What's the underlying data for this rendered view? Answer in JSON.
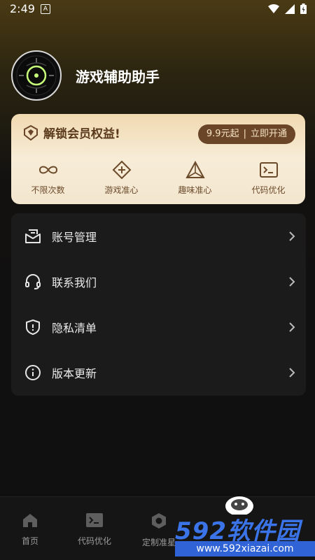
{
  "status": {
    "time": "2:49",
    "notif_glyph": "A"
  },
  "profile": {
    "name": "游戏辅助助手"
  },
  "vip": {
    "title": "解锁会员权益!",
    "price": "9.9元起",
    "action": "立即开通",
    "items": [
      {
        "label": "不限次数",
        "icon": "infinity-icon"
      },
      {
        "label": "游戏准心",
        "icon": "crosshair-diamond-icon"
      },
      {
        "label": "趣味准心",
        "icon": "triangle-icon"
      },
      {
        "label": "代码优化",
        "icon": "terminal-icon"
      }
    ]
  },
  "menu": [
    {
      "label": "账号管理",
      "icon": "mail-icon"
    },
    {
      "label": "联系我们",
      "icon": "headset-icon"
    },
    {
      "label": "隐私清单",
      "icon": "shield-icon"
    },
    {
      "label": "版本更新",
      "icon": "info-icon"
    }
  ],
  "tabs": [
    {
      "label": "首页",
      "icon": "home-icon"
    },
    {
      "label": "代码优化",
      "icon": "terminal-icon"
    },
    {
      "label": "定制准星",
      "icon": "hexagon-icon"
    }
  ],
  "watermark": {
    "brand": "592软件园",
    "url": "www.592xiazai.com"
  },
  "colors": {
    "accent_gold": "#f0d9b0",
    "vip_brown": "#6a4527",
    "card_bg": "#1b1b1c"
  }
}
